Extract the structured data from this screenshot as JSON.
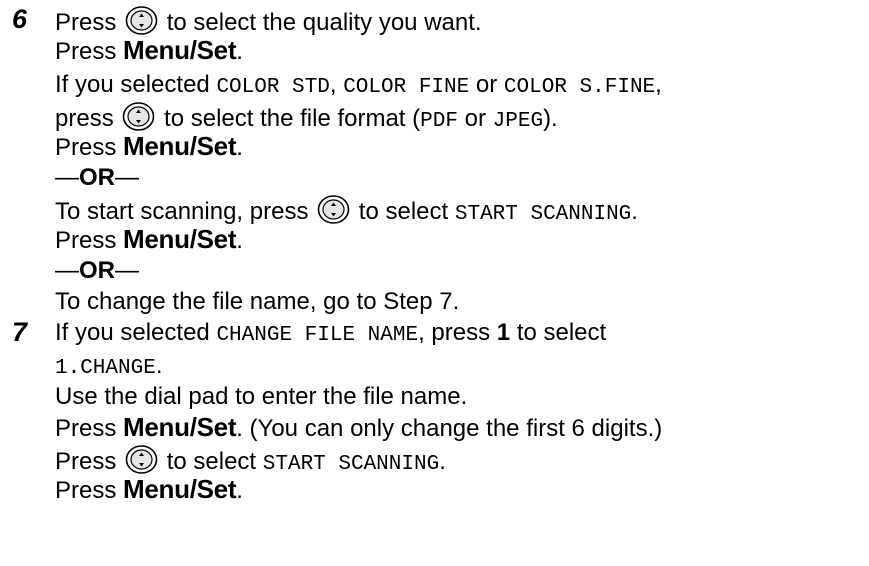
{
  "step6": {
    "number": "6",
    "l1_a": "Press",
    "l1_icon": "up-down-arrow-button-icon",
    "l1_b": "to select the quality you want.",
    "l2_a": "Press",
    "l2_key": "Menu/Set",
    "l2_b": ".",
    "l3_a": "If you selected",
    "l3_m1": "COLOR STD",
    "l3_sep1": ",",
    "l3_m2": "COLOR FINE",
    "l3_or": "or",
    "l3_m3": "COLOR S.FINE",
    "l3_end": ",",
    "l4_a": "press",
    "l4_b": "to select the file format (",
    "l4_m1": "PDF",
    "l4_or": "or",
    "l4_m2": "JPEG",
    "l4_end": ").",
    "l5_a": "Press",
    "l5_key": "Menu/Set",
    "l5_b": ".",
    "or1_dash1": "—",
    "or1": "OR",
    "or1_dash2": "—",
    "l7_a": "To start scanning, press",
    "l7_b": "to select",
    "l7_m": "START SCANNING",
    "l7_end": ".",
    "l8_a": "Press",
    "l8_key": "Menu/Set",
    "l8_b": ".",
    "or2_dash1": "—",
    "or2": "OR",
    "or2_dash2": "—",
    "l10": "To change the file name, go to Step 7."
  },
  "step7": {
    "number": "7",
    "l1_a": "If you selected",
    "l1_m": "CHANGE FILE NAME",
    "l1_b": ", press",
    "l1_key": "1",
    "l1_c": "to select",
    "l2_m": "1.CHANGE",
    "l2_end": ".",
    "l3": "Use the dial pad to enter the file name.",
    "l4_a": "Press",
    "l4_key": "Menu/Set",
    "l4_b": ". (You can only change the first 6 digits.)",
    "l5_a": "Press",
    "l5_b": "to select",
    "l5_m": "START SCANNING",
    "l5_end": ".",
    "l6_a": "Press",
    "l6_key": "Menu/Set",
    "l6_b": "."
  }
}
